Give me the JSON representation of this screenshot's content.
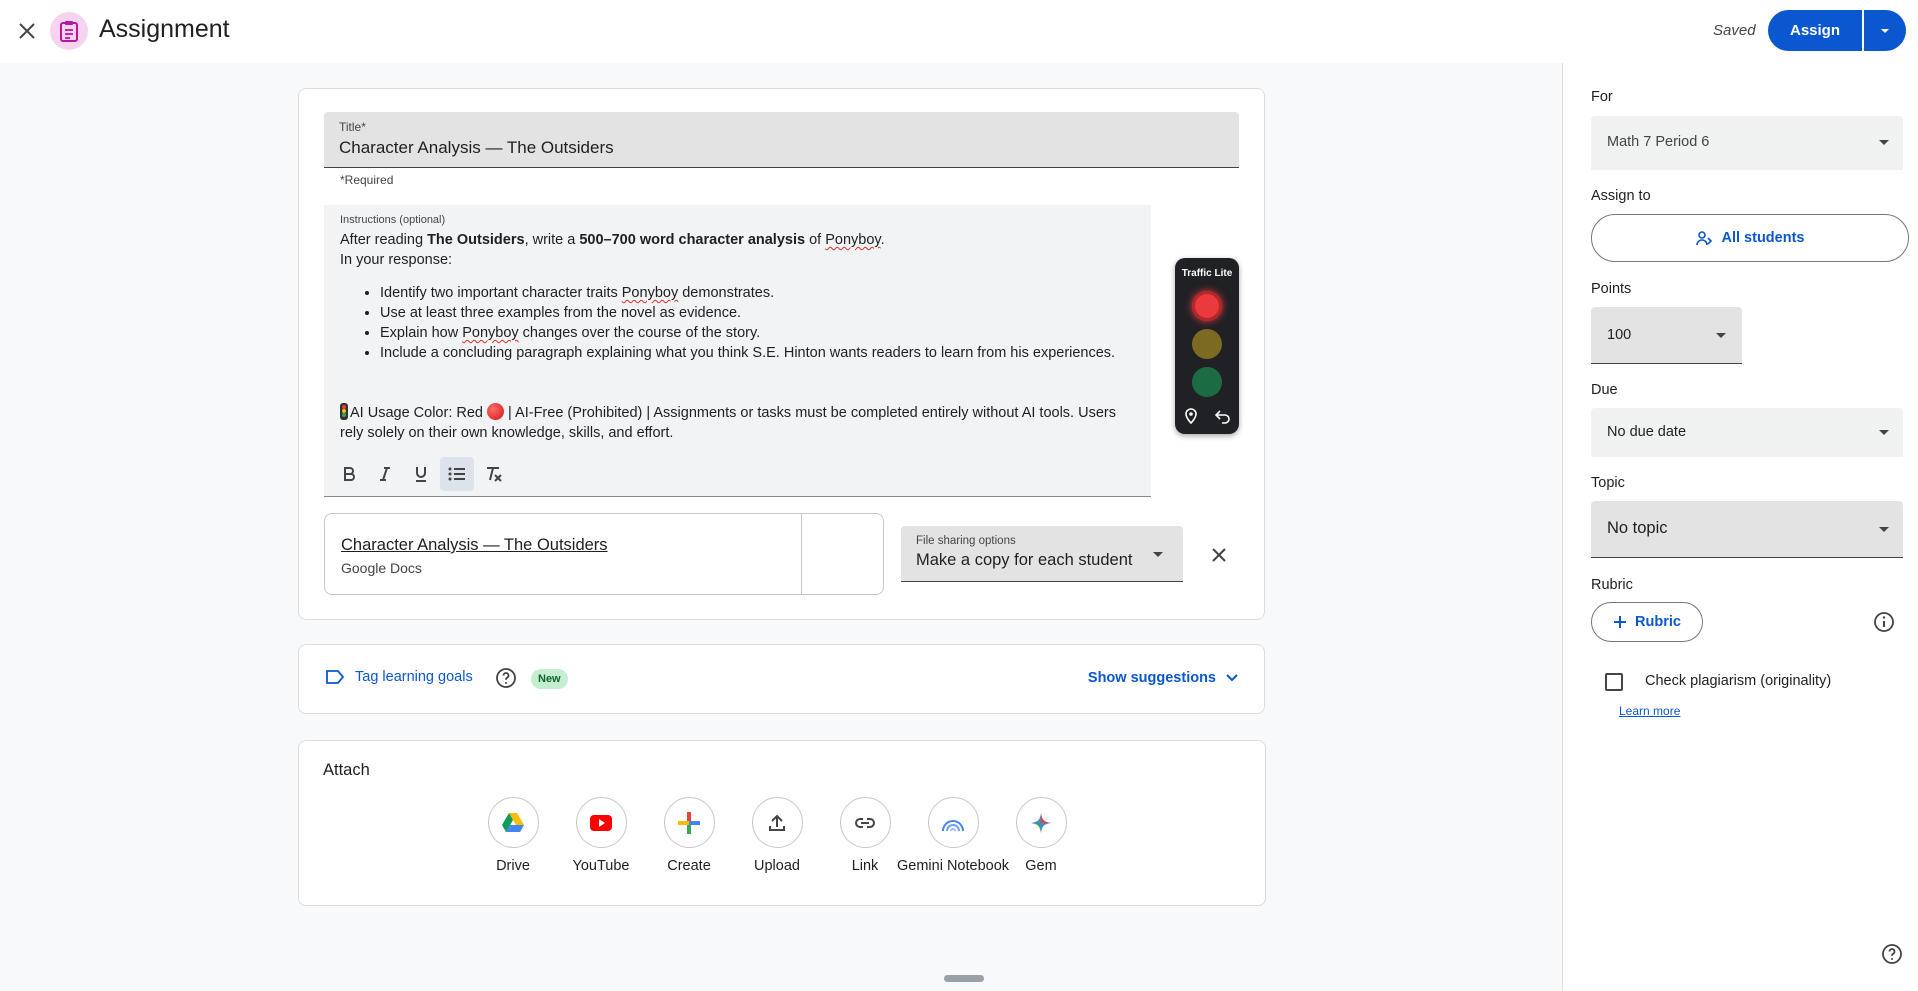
{
  "header": {
    "title": "Assignment",
    "saved": "Saved",
    "assign_label": "Assign"
  },
  "form": {
    "title_label": "Title*",
    "title_value": "Character Analysis — The Outsiders",
    "required_note": "*Required",
    "instructions_label": "Instructions (optional)",
    "instructions": {
      "intro_1": "After reading ",
      "book": "The Outsiders",
      "intro_2": ", write a ",
      "length": "500–700 word character analysis",
      "intro_3": " of ",
      "character": "Ponyboy",
      "intro_4": ".",
      "line2": "In your response:",
      "bullets": [
        {
          "pre": "Identify two important character traits ",
          "name": "Ponyboy",
          "post": " demonstrates."
        },
        {
          "pre": "Use at least three examples from the novel as evidence.",
          "name": "",
          "post": ""
        },
        {
          "pre": "Explain how ",
          "name": "Ponyboy",
          "post": " changes over the course of the story."
        },
        {
          "pre": "Include a concluding paragraph explaining what you think S.E. Hinton wants readers to learn from his experiences.",
          "name": "",
          "post": ""
        }
      ],
      "ai_pre": "AI Usage Color: Red ",
      "ai_post": " | AI-Free (Prohibited) | Assignments or tasks must be completed entirely without AI tools. Users rely solely on their own knowledge, skills, and effort."
    },
    "format_tools": [
      "bold-icon",
      "italic-icon",
      "underline-icon",
      "bulleted-list-icon",
      "clear-formatting-icon"
    ],
    "traffic_widget": {
      "label": "Traffic Lite",
      "active": "red"
    },
    "attachment": {
      "name": "Character Analysis — The Outsiders",
      "type": "Google Docs",
      "sharing_label": "File sharing options",
      "sharing_value": "Make a copy for each student"
    }
  },
  "goals": {
    "tag_label": "Tag learning goals",
    "badge": "New",
    "suggestions": "Show suggestions"
  },
  "attach": {
    "title": "Attach",
    "items": [
      {
        "label": "Drive",
        "icon": "drive-icon"
      },
      {
        "label": "YouTube",
        "icon": "youtube-icon"
      },
      {
        "label": "Create",
        "icon": "create-plus-icon"
      },
      {
        "label": "Upload",
        "icon": "upload-icon"
      },
      {
        "label": "Link",
        "icon": "link-icon"
      },
      {
        "label": "Gemini Notebook",
        "icon": "gemini-notebook-icon"
      },
      {
        "label": "Gem",
        "icon": "gem-icon"
      }
    ]
  },
  "sidebar": {
    "for_label": "For",
    "for_value": "Math 7 Period 6",
    "assign_to_label": "Assign to",
    "assign_to_value": "All students",
    "points_label": "Points",
    "points_value": "100",
    "due_label": "Due",
    "due_value": "No due date",
    "topic_label": "Topic",
    "topic_value": "No topic",
    "rubric_label": "Rubric",
    "rubric_button": "Rubric",
    "plagiarism_label": "Check plagiarism (originality)",
    "plagiarism_checked": false,
    "learn_more": "Learn more"
  },
  "colors": {
    "accent": "#0b57d0",
    "traffic_red": "#ea3a3d",
    "badge_bg": "#c4eed0"
  }
}
